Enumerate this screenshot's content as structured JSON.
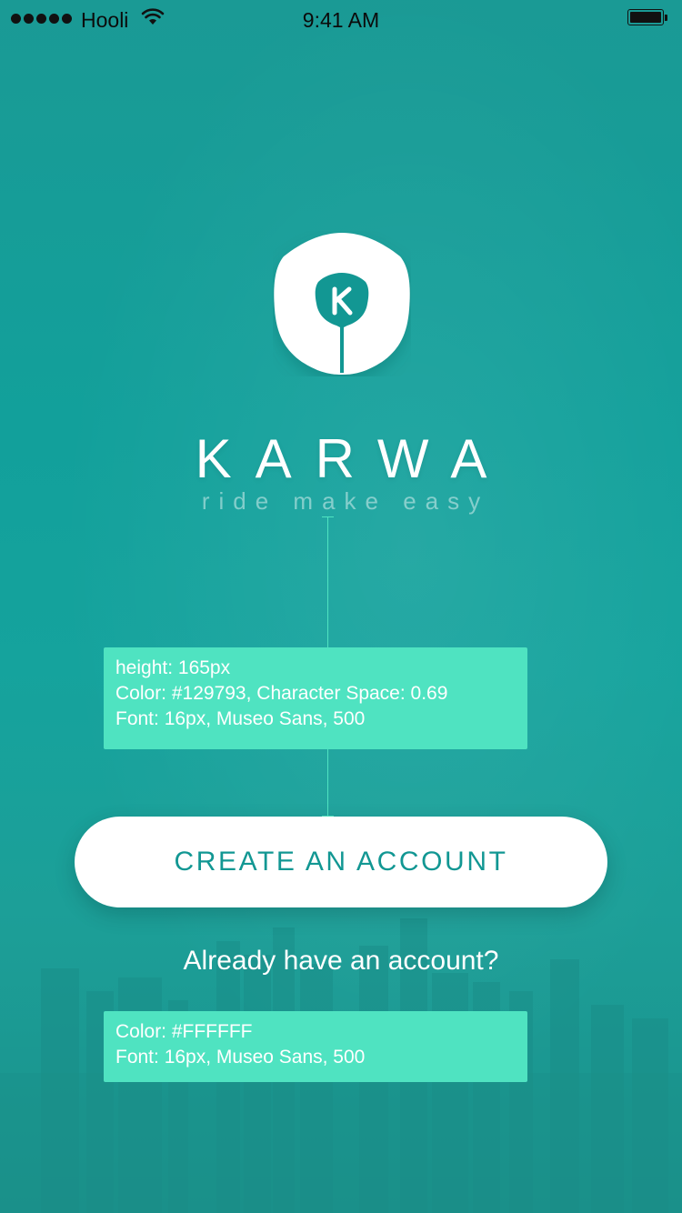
{
  "status_bar": {
    "carrier": "Hooli",
    "time": "9:41 AM",
    "battery_level": 1.0
  },
  "brand": {
    "logo_letter": "K",
    "name": "KARWA",
    "tagline": "ride make easy",
    "colors": {
      "primary": "#129793",
      "annotation": "#4fe3c1",
      "text_light": "#FFFFFF"
    }
  },
  "annotations": {
    "spacing": {
      "lines": [
        "height: 165px",
        "Color: #129793, Character Space: 0.69",
        "Font: 16px, Museo Sans, 500"
      ]
    },
    "link_spec": {
      "lines": [
        "Color: #FFFFFF",
        "Font: 16px, Museo Sans, 500"
      ]
    }
  },
  "actions": {
    "create_account_label": "CREATE AN ACCOUNT",
    "login_label": "Already have an account?"
  },
  "icons": {
    "signal": "signal-dots-icon",
    "wifi": "wifi-icon",
    "battery": "battery-icon",
    "logo": "karwa-logo-icon"
  }
}
